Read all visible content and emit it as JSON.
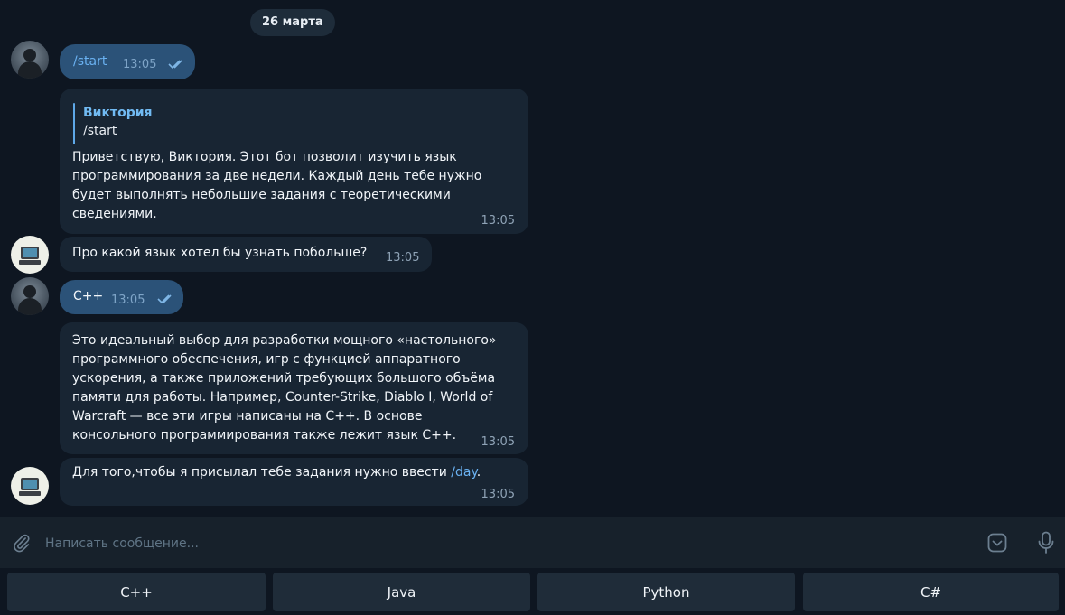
{
  "chat": {
    "date": "26 марта",
    "messages": [
      {
        "text": "/start",
        "time": "13:05"
      },
      {
        "reply_name": "Виктория",
        "reply_text": "/start",
        "text": "Приветствую, Виктория. Этот бот позволит изучить язык\nпрограммирования за две недели. Каждый день тебе нужно\nбудет выполнять небольшие задания с теоретическими\nсведениями.",
        "time": "13:05"
      },
      {
        "text": "Про какой язык хотел бы узнать побольше?",
        "time": "13:05"
      },
      {
        "text": "C++",
        "time": "13:05"
      },
      {
        "text": "Это идеальный выбор для разработки мощного «настольного»\nпрограммного обеспечения, игр с функцией аппаратного\nускорения, а также приложений требующих большого объёма\nпамяти для работы. Например, Counter-Strike, Diablo I, World of\nWarcraft — все эти игры написаны на C++. В основе\nконсольного программирования также лежит язык C++.",
        "time": "13:05"
      },
      {
        "text_before": "Для того,чтобы я присылал тебе задания нужно ввести ",
        "link": "/day",
        "text_after": ".",
        "time": "13:05"
      }
    ]
  },
  "input": {
    "placeholder": "Написать сообщение...",
    "icons": [
      "paperclip-icon",
      "emoji-keyboard-icon",
      "microphone-icon"
    ]
  },
  "keyboard": {
    "buttons": [
      "C++",
      "Java",
      "Python",
      "C#"
    ]
  },
  "colors": {
    "background": "#0e1621",
    "outgoing_bubble": "#2b5278",
    "incoming_bubble": "#182533",
    "accent": "#6ab2f2",
    "keyboard_button": "#1f2c39"
  }
}
